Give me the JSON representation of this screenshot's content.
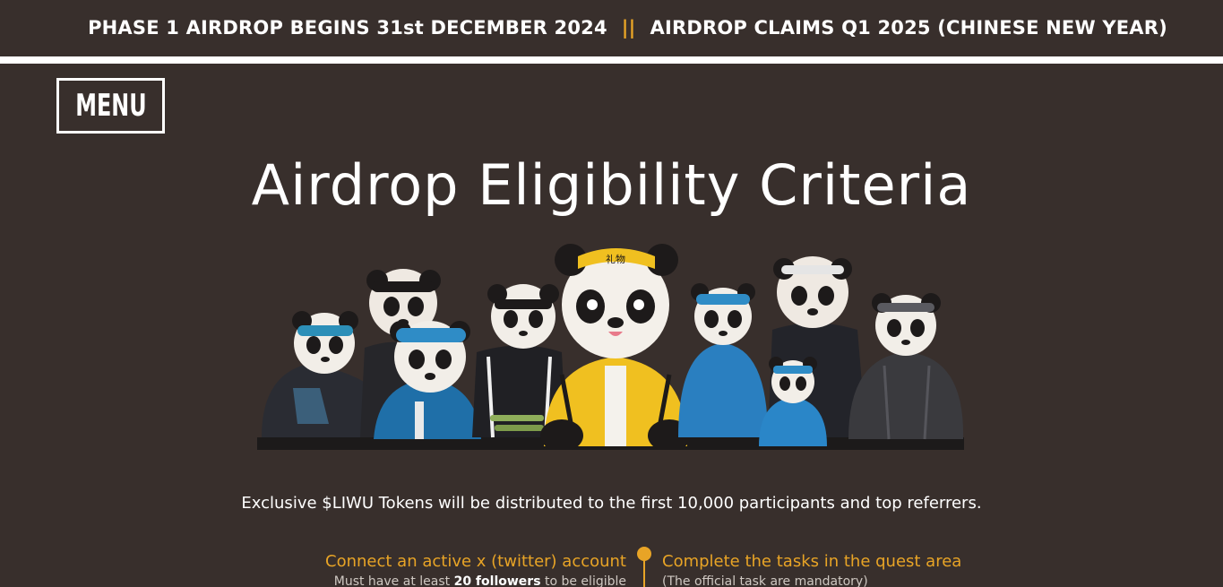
{
  "ticker": {
    "left": "PHASE 1 AIRDROP BEGINS 31st DECEMBER 2024",
    "separator": "||",
    "right": "AIRDROP CLAIMS Q1 2025 (CHINESE NEW YEAR)"
  },
  "nav": {
    "menu_label": "MENU"
  },
  "page": {
    "title": "Airdrop Eligibility Criteria",
    "subtitle": "Exclusive $LIWU Tokens will be distributed to the first 10,000 participants and top referrers."
  },
  "hero_image": {
    "badge_text": "礼物"
  },
  "criteria": [
    {
      "heading": "Connect an active x (twitter) account",
      "sub_prefix": "Must have at least ",
      "sub_bold": "20 followers",
      "sub_suffix": " to be eligible"
    },
    {
      "heading": "Complete the tasks in the quest area",
      "sub": "(The official task are mandatory)"
    }
  ],
  "colors": {
    "background": "#382f2c",
    "accent": "#e8a426",
    "text": "#ffffff"
  }
}
